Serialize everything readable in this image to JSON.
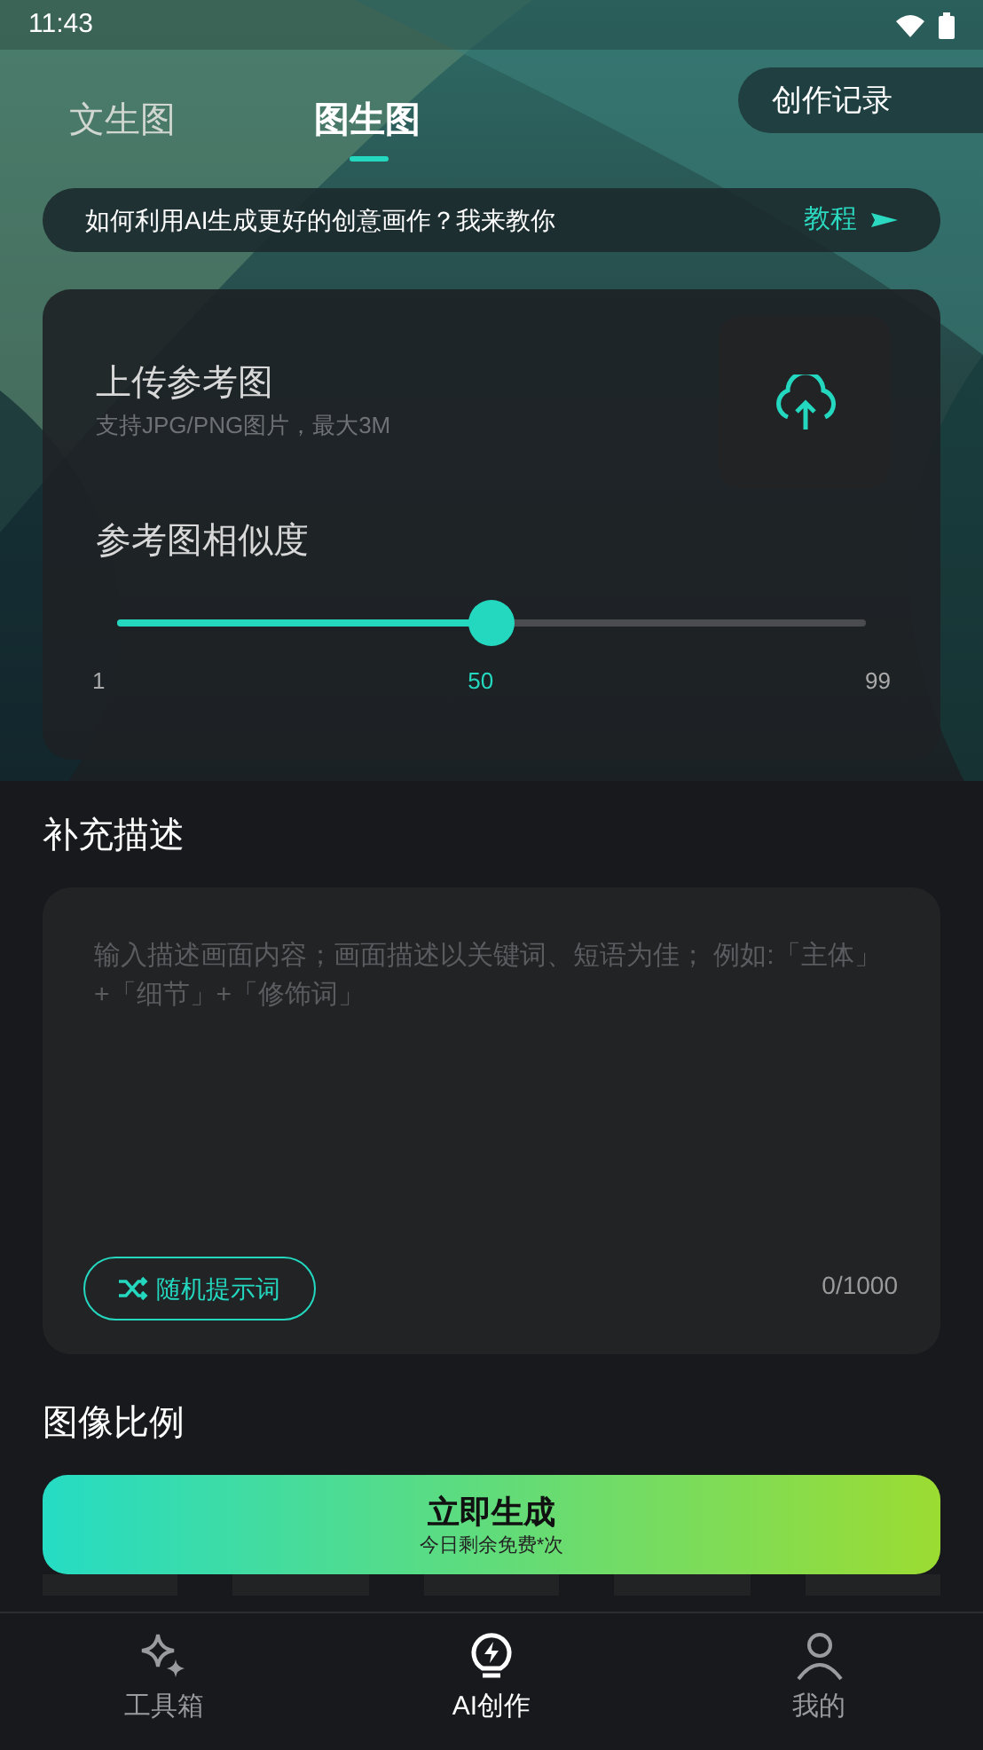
{
  "status_bar": {
    "time": "11:43"
  },
  "tabs": [
    {
      "label": "文生图",
      "selected": false
    },
    {
      "label": "图生图",
      "selected": true
    }
  ],
  "history_button": "创作记录",
  "banner": {
    "text": "如何利用AI生成更好的创意画作？我来教你",
    "link": "教程"
  },
  "upload": {
    "title": "上传参考图",
    "hint": "支持JPG/PNG图片，最大3M"
  },
  "similarity": {
    "title": "参考图相似度",
    "level": 0.5,
    "min": "1",
    "value": "50",
    "max": "99"
  },
  "description": {
    "title": "补充描述",
    "placeholder": "输入描述画面内容；画面描述以关键词、短语为佳； 例如:「主体」+「细节」+「修饰词」",
    "random_button": "随机提示词",
    "counter": "0/1000"
  },
  "ratio_title": "图像比例",
  "generate": {
    "label": "立即生成",
    "sub": "今日剩余免费*次"
  },
  "nav": [
    {
      "label": "工具箱",
      "kind": "tools",
      "selected": false
    },
    {
      "label": "AI创作",
      "kind": "create",
      "selected": true
    },
    {
      "label": "我的",
      "kind": "profile",
      "selected": false
    }
  ]
}
